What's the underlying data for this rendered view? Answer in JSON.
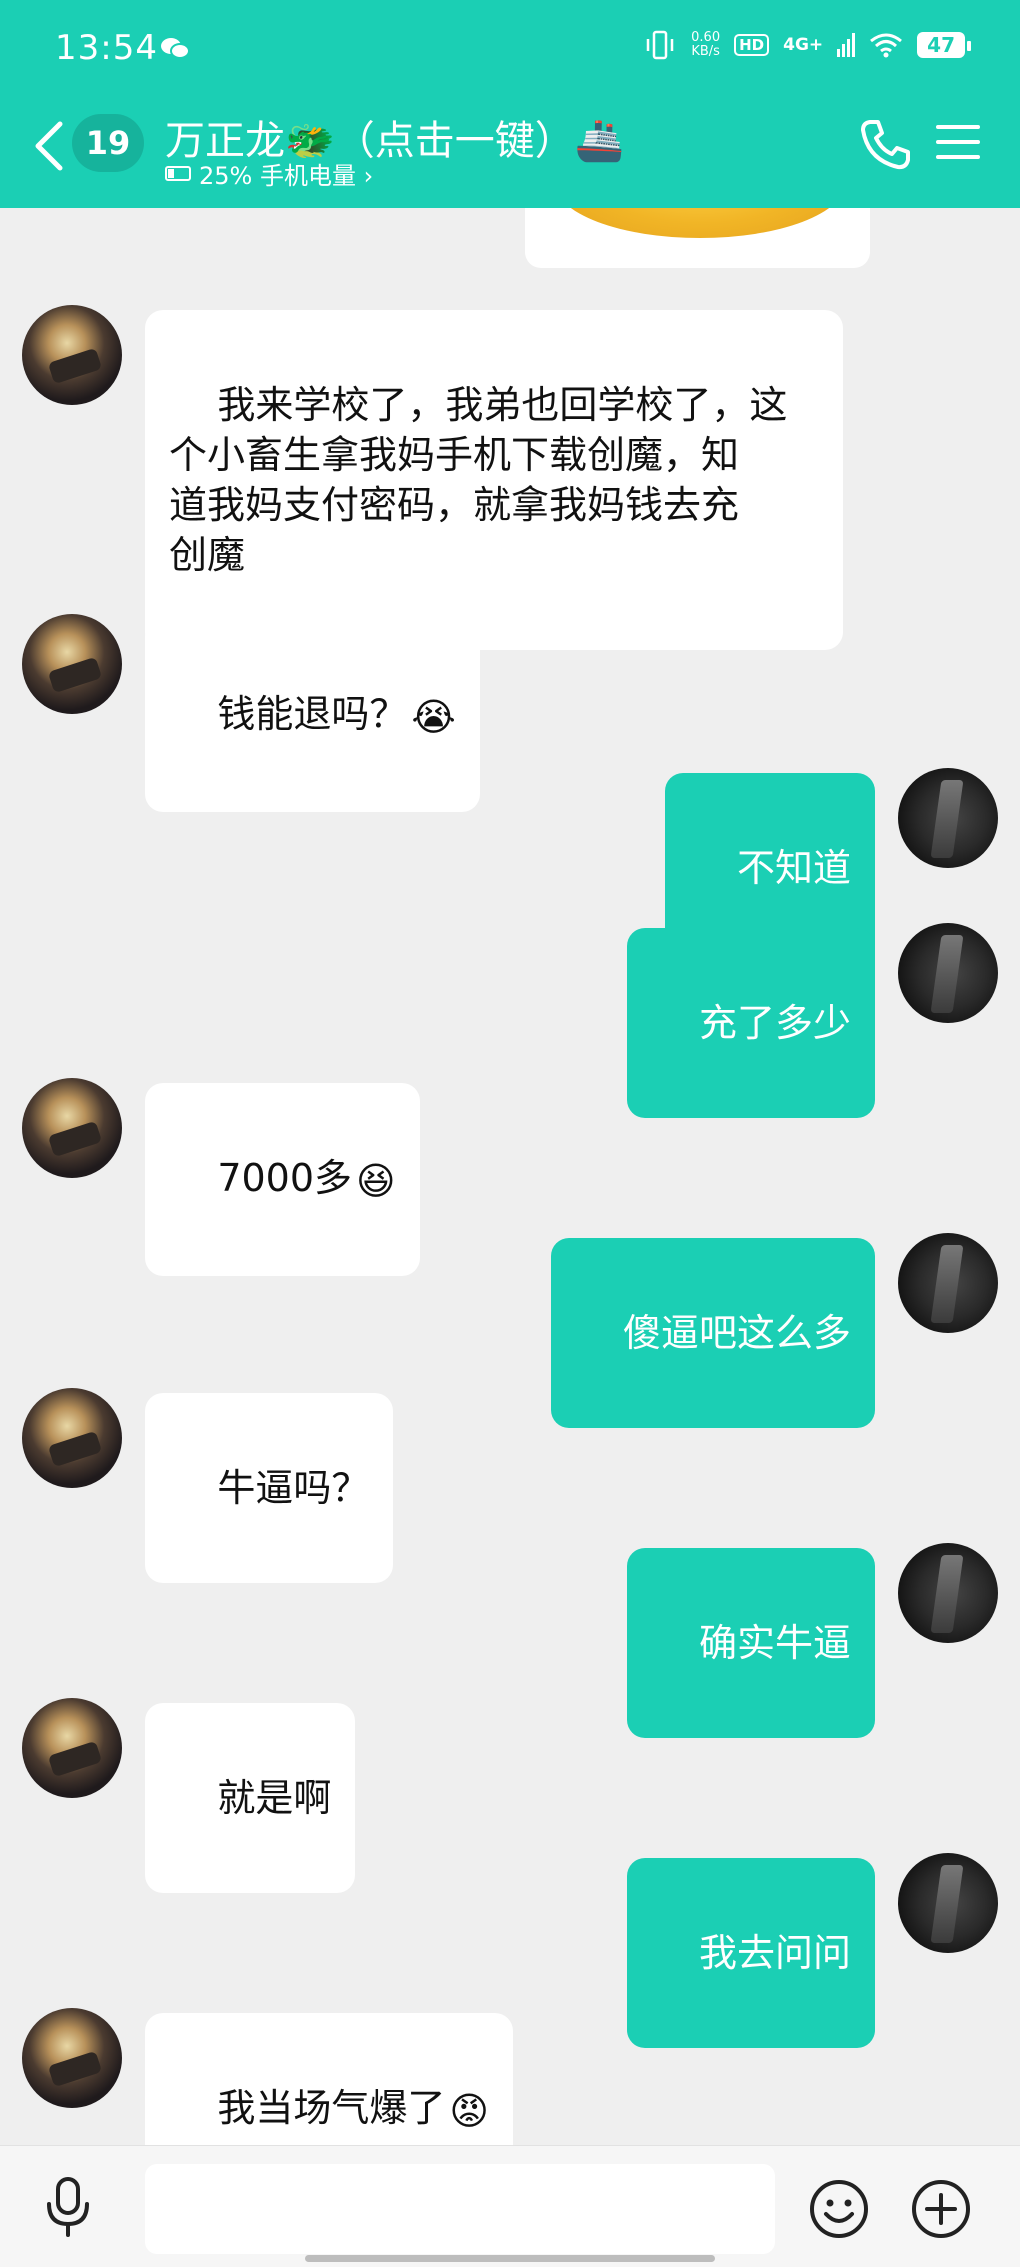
{
  "status_bar": {
    "time": "13:54",
    "net_speed_value": "0.60",
    "net_speed_unit": "KB/s",
    "hd_label": "HD",
    "network_label": "4G+",
    "battery_level": "47",
    "icons": [
      "wechat-icon",
      "vibrate-icon",
      "signal-icon",
      "wifi-icon",
      "battery-icon"
    ]
  },
  "header": {
    "unread_count": "19",
    "title": "万正龙🐲（点击一键）🚢",
    "subtitle": "25% 手机电量 ›",
    "icons": [
      "back-icon",
      "phone-icon",
      "menu-icon"
    ]
  },
  "messages": [
    {
      "side": "left",
      "text": "我来学校了，我弟也回学校了，这\n个小畜生拿我妈手机下载创魔，知\n道我妈支付密码，就拿我妈钱去充\n创魔",
      "emoji": ""
    },
    {
      "side": "left",
      "text": "钱能退吗？",
      "emoji": "😭"
    },
    {
      "side": "right",
      "text": "不知道",
      "emoji": ""
    },
    {
      "side": "right",
      "text": "充了多少",
      "emoji": ""
    },
    {
      "side": "left",
      "text": "7000多",
      "emoji": "😆"
    },
    {
      "side": "right",
      "text": "傻逼吧这么多",
      "emoji": ""
    },
    {
      "side": "left",
      "text": "牛逼吗？",
      "emoji": ""
    },
    {
      "side": "right",
      "text": "确实牛逼",
      "emoji": ""
    },
    {
      "side": "left",
      "text": "就是啊",
      "emoji": ""
    },
    {
      "side": "right",
      "text": "我去问问",
      "emoji": ""
    },
    {
      "side": "left",
      "text": "我当场气爆了",
      "emoji": "😡"
    }
  ],
  "input_bar": {
    "value": "",
    "icons": [
      "mic-icon",
      "emoji-icon",
      "plus-icon"
    ]
  },
  "colors": {
    "accent": "#1bcfb4",
    "chat_background": "#efefef",
    "bubble_left": "#ffffff"
  }
}
